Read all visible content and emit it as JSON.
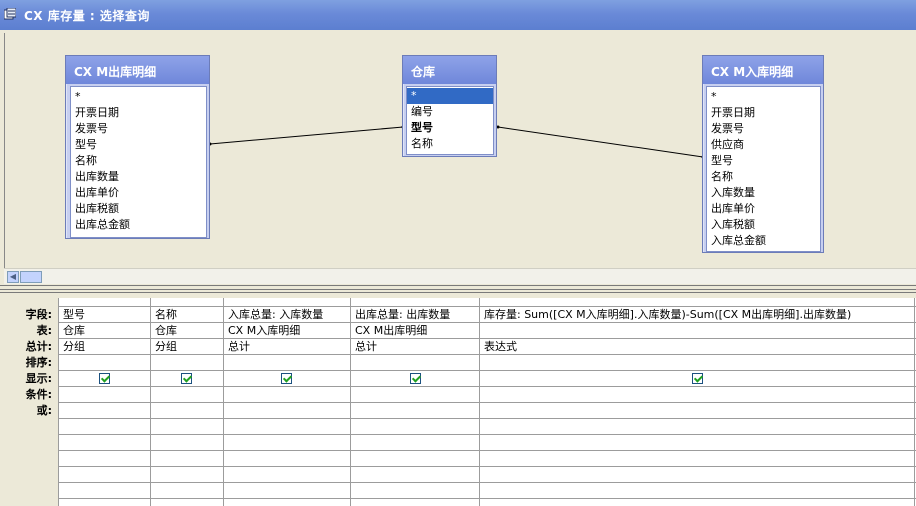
{
  "window": {
    "title": "CX 库存量 : 选择查询"
  },
  "tables": [
    {
      "name": "CX M出库明细",
      "fields": [
        "*",
        "开票日期",
        "发票号",
        "型号",
        "名称",
        "出库数量",
        "出库单价",
        "出库税额",
        "出库总金额"
      ]
    },
    {
      "name": "仓库",
      "fields": [
        "*",
        "编号",
        "型号",
        "名称"
      ],
      "selected_index": 0,
      "bold_index": 2
    },
    {
      "name": "CX M入库明细",
      "fields": [
        "*",
        "开票日期",
        "发票号",
        "供应商",
        "型号",
        "名称",
        "入库数量",
        "出库单价",
        "入库税额",
        "入库总金额"
      ]
    }
  ],
  "grid": {
    "row_labels": [
      "字段:",
      "表:",
      "总计:",
      "排序:",
      "显示:",
      "条件:",
      "或:"
    ],
    "columns": [
      {
        "field": "型号",
        "table": "仓库",
        "total": "分组",
        "sort": "",
        "show": true
      },
      {
        "field": "名称",
        "table": "仓库",
        "total": "分组",
        "sort": "",
        "show": true
      },
      {
        "field": "入库总量: 入库数量",
        "table": "CX M入库明细",
        "total": "总计",
        "sort": "",
        "show": true
      },
      {
        "field": "出库总量: 出库数量",
        "table": "CX M出库明细",
        "total": "总计",
        "sort": "",
        "show": true
      },
      {
        "field": "库存量: Sum([CX M入库明细].入库数量)-Sum([CX M出库明细].出库数量)",
        "table": "",
        "total": "表达式",
        "sort": "",
        "show": true
      }
    ]
  }
}
